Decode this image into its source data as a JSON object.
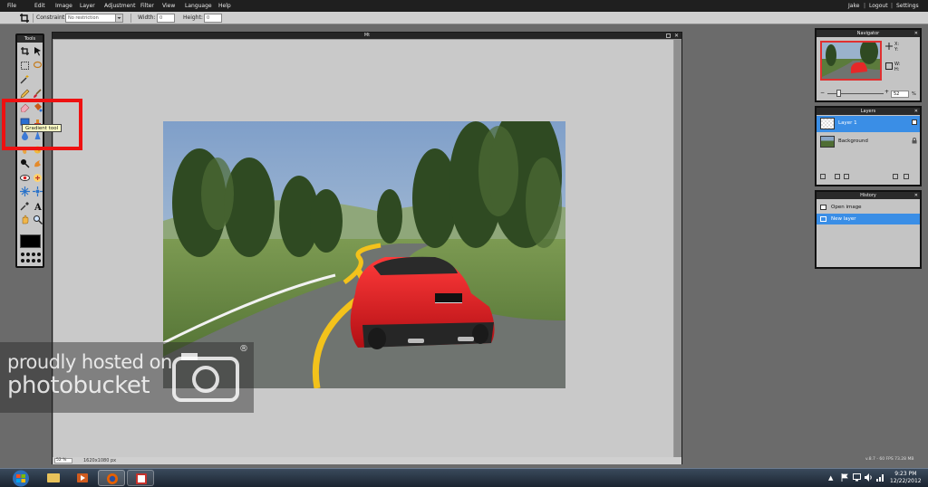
{
  "menu": {
    "items": [
      "File",
      "Edit",
      "Image",
      "Layer",
      "Adjustment",
      "Filter",
      "View",
      "Language",
      "Help"
    ],
    "user": "Jake",
    "logout": "Logout",
    "settings": "Settings",
    "sep1": "|",
    "sep2": "|"
  },
  "options": {
    "constraint_label": "Constraint:",
    "constraint_value": "No restriction",
    "width_label": "Width:",
    "width_value": "0",
    "height_label": "Height:",
    "height_value": "0"
  },
  "tools": {
    "title": "Tools",
    "tooltip": "Gradient tool",
    "icons": [
      "crop-icon",
      "move-icon",
      "marquee-icon",
      "lasso-icon",
      "wand-icon",
      "blank",
      "pencil-icon",
      "brush-icon",
      "eraser-icon",
      "bucket-icon",
      "gradient-icon",
      "stamp-icon",
      "blur-icon",
      "sharpen-icon",
      "smudge-icon",
      "sponge-icon",
      "dodge-icon",
      "burn-icon",
      "redeye-icon",
      "spot-heal-icon",
      "bloat-icon",
      "pinch-icon",
      "picker-icon",
      "type-icon",
      "hand-icon",
      "zoom-icon"
    ]
  },
  "document": {
    "title": "Mt",
    "zoom": "52",
    "zoom_unit": "%",
    "dimensions": "1620x1080 px"
  },
  "navigator": {
    "title": "Navigator",
    "x_label": "X:",
    "y_label": "Y:",
    "w_label": "W:",
    "h_label": "H:",
    "zoom": "52",
    "zoom_unit": "%",
    "slider_level": 0.2
  },
  "layers": {
    "title": "Layers",
    "items": [
      {
        "name": "Layer 1",
        "selected": true
      },
      {
        "name": "Background",
        "selected": false
      }
    ]
  },
  "history": {
    "title": "History",
    "items": [
      {
        "name": "Open image",
        "selected": false
      },
      {
        "name": "New layer",
        "selected": true
      }
    ]
  },
  "watermark": {
    "line1": "proudly hosted on",
    "line2": "photobucket",
    "reg": "®"
  },
  "status": {
    "version": "v.8.7 - 60 FPS 73.28 MB"
  },
  "taskbar": {
    "time": "9:23 PM",
    "date": "12/22/2012"
  },
  "colors": {
    "accent_blue": "#3a8ee6",
    "highlight_red": "#ee1111",
    "tooltip_bg": "#ffffc6",
    "taskbar": "#1b2430"
  }
}
